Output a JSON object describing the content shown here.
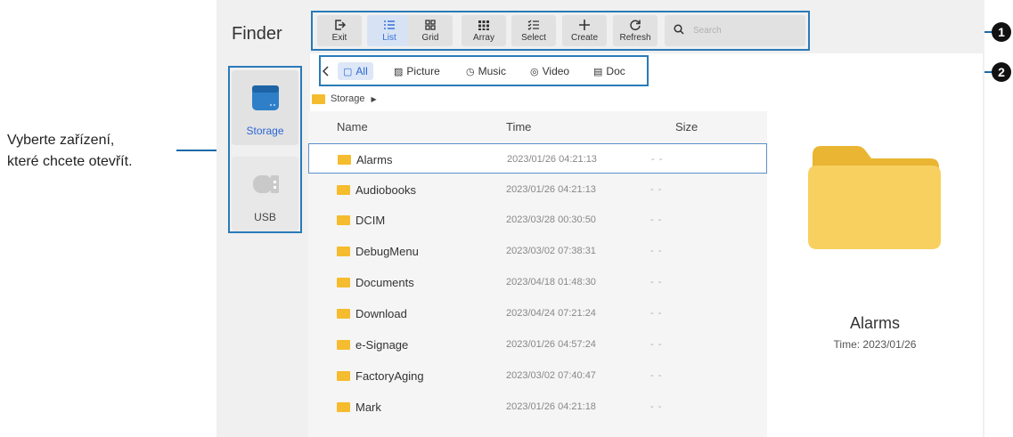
{
  "annotation": {
    "line1": "Vyberte zařízení,",
    "line2": "které chcete otevřít."
  },
  "badges": [
    "1",
    "2"
  ],
  "colors": {
    "accent": "#2b66d6",
    "frame": "#2a7ab8",
    "folder": "#f4bc2e"
  },
  "app": {
    "title": "Finder"
  },
  "toolbar": {
    "buttons": [
      {
        "label": "Exit",
        "icon": "exit-icon"
      },
      {
        "label": "List",
        "icon": "list-icon",
        "active": true
      },
      {
        "label": "Grid",
        "icon": "grid-icon"
      },
      {
        "label": "Array",
        "icon": "array-icon"
      },
      {
        "label": "Select",
        "icon": "select-icon"
      },
      {
        "label": "Create",
        "icon": "plus-icon"
      },
      {
        "label": "Refresh",
        "icon": "refresh-icon"
      }
    ],
    "search_placeholder": "Search"
  },
  "sidebar": {
    "items": [
      {
        "label": "Storage",
        "icon": "storage-icon",
        "active": true
      },
      {
        "label": "USB",
        "icon": "usb-icon"
      }
    ]
  },
  "tabs": [
    {
      "label": "All",
      "icon": "all-icon",
      "active": true
    },
    {
      "label": "Picture",
      "icon": "picture-icon"
    },
    {
      "label": "Music",
      "icon": "music-icon"
    },
    {
      "label": "Video",
      "icon": "video-icon"
    },
    {
      "label": "Doc",
      "icon": "doc-icon"
    }
  ],
  "breadcrumb": {
    "label": "Storage"
  },
  "list": {
    "columns": [
      "Name",
      "Time",
      "Size"
    ],
    "rows": [
      {
        "name": "Alarms",
        "time": "2023/01/26 04:21:13",
        "size": "- -"
      },
      {
        "name": "Audiobooks",
        "time": "2023/01/26 04:21:13",
        "size": "- -"
      },
      {
        "name": "DCIM",
        "time": "2023/03/28 00:30:50",
        "size": "- -"
      },
      {
        "name": "DebugMenu",
        "time": "2023/03/02 07:38:31",
        "size": "- -"
      },
      {
        "name": "Documents",
        "time": "2023/04/18 01:48:30",
        "size": "- -"
      },
      {
        "name": "Download",
        "time": "2023/04/24 07:21:24",
        "size": "- -"
      },
      {
        "name": "e-Signage",
        "time": "2023/01/26 04:57:24",
        "size": "- -"
      },
      {
        "name": "FactoryAging",
        "time": "2023/03/02 07:40:47",
        "size": "- -"
      },
      {
        "name": "Mark",
        "time": "2023/01/26 04:21:18",
        "size": "- -"
      }
    ]
  },
  "preview": {
    "name": "Alarms",
    "time": "Time: 2023/01/26"
  }
}
